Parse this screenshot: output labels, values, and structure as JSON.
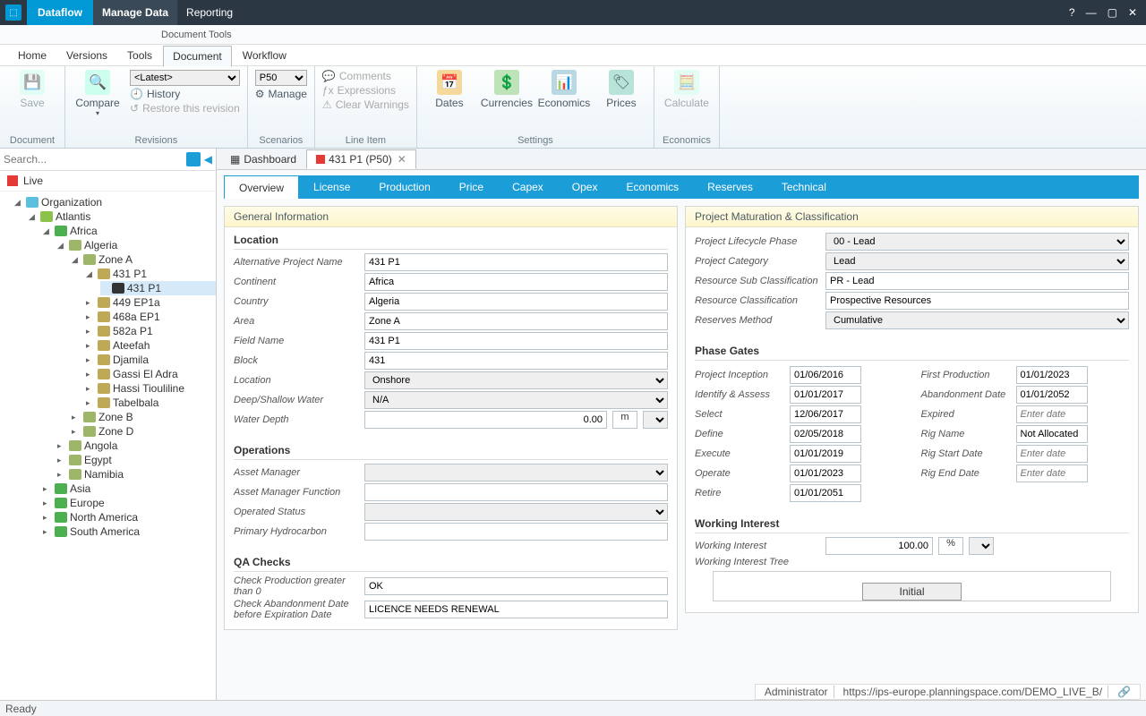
{
  "titlebar": {
    "brand": "Dataflow",
    "tabs": [
      "Manage Data",
      "Reporting"
    ],
    "active": 0
  },
  "contextual": "Document Tools",
  "menu": {
    "items": [
      "Home",
      "Versions",
      "Tools",
      "Document",
      "Workflow"
    ],
    "active": 3
  },
  "ribbon": {
    "document": {
      "label": "Document",
      "save": "Save",
      "compare": "Compare"
    },
    "revisions": {
      "label": "Revisions",
      "dropdown": "<Latest>",
      "history": "History",
      "restore": "Restore this revision"
    },
    "scenarios": {
      "label": "Scenarios",
      "dropdown": "P50",
      "manage": "Manage"
    },
    "lineitem": {
      "label": "Line Item",
      "comments": "Comments",
      "expressions": "Expressions",
      "clear": "Clear Warnings"
    },
    "settings": {
      "label": "Settings",
      "dates": "Dates",
      "currencies": "Currencies",
      "economics": "Economics",
      "prices": "Prices"
    },
    "economics": {
      "label": "Economics",
      "calculate": "Calculate"
    }
  },
  "left": {
    "search_placeholder": "Search...",
    "live": "Live",
    "tree": {
      "root": "Organization",
      "atlantis": "Atlantis",
      "africa": "Africa",
      "algeria": "Algeria",
      "zoneA": "Zone A",
      "p431p1_parent": "431 P1",
      "p431p1": "431 P1",
      "ep449": "449 EP1a",
      "ep468": "468a EP1",
      "p582": "582a P1",
      "ateefah": "Ateefah",
      "djamila": "Djamila",
      "gassi": "Gassi El Adra",
      "hassi": "Hassi Tiouliline",
      "tabel": "Tabelbala",
      "zoneB": "Zone B",
      "zoneD": "Zone D",
      "angola": "Angola",
      "egypt": "Egypt",
      "namibia": "Namibia",
      "asia": "Asia",
      "europe": "Europe",
      "northam": "North America",
      "southam": "South America"
    }
  },
  "doctabs": {
    "dashboard": "Dashboard",
    "active": "431 P1 (P50)"
  },
  "subtabs": [
    "Overview",
    "License",
    "Production",
    "Price",
    "Capex",
    "Opex",
    "Economics",
    "Reserves",
    "Technical"
  ],
  "form": {
    "general_title": "General Information",
    "location_hdr": "Location",
    "location": {
      "alt_name_l": "Alternative Project Name",
      "alt_name": "431 P1",
      "continent_l": "Continent",
      "continent": "Africa",
      "country_l": "Country",
      "country": "Algeria",
      "area_l": "Area",
      "area": "Zone A",
      "field_l": "Field Name",
      "field": "431 P1",
      "block_l": "Block",
      "block": "431",
      "loc_l": "Location",
      "loc": "Onshore",
      "water_l": "Deep/Shallow Water",
      "water": "N/A",
      "depth_l": "Water Depth",
      "depth": "0.00",
      "depth_unit": "m"
    },
    "ops_hdr": "Operations",
    "ops": {
      "mgr_l": "Asset Manager",
      "func_l": "Asset Manager Function",
      "status_l": "Operated Status",
      "hydro_l": "Primary Hydrocarbon"
    },
    "qa_hdr": "QA Checks",
    "qa": {
      "prod_l": "Check Production greater than 0",
      "prod": "OK",
      "aband_l": "Check Abandonment Date before Expiration Date",
      "aband": "LICENCE NEEDS RENEWAL"
    },
    "maturation_title": "Project Maturation & Classification",
    "mat": {
      "phase_l": "Project Lifecycle Phase",
      "phase": "00 - Lead",
      "cat_l": "Project Category",
      "cat": "Lead",
      "sub_l": "Resource Sub Classification",
      "sub": "PR - Lead",
      "class_l": "Resource Classification",
      "class": "Prospective Resources",
      "method_l": "Reserves Method",
      "method": "Cumulative"
    },
    "phase_hdr": "Phase Gates",
    "phase": {
      "inception_l": "Project Inception",
      "inception": "01/06/2016",
      "identify_l": "Identify & Assess",
      "identify": "01/01/2017",
      "select_l": "Select",
      "select": "12/06/2017",
      "define_l": "Define",
      "define": "02/05/2018",
      "execute_l": "Execute",
      "execute": "01/01/2019",
      "operate_l": "Operate",
      "operate": "01/01/2023",
      "retire_l": "Retire",
      "retire": "01/01/2051",
      "firstprod_l": "First Production",
      "firstprod": "01/01/2023",
      "aband_l": "Abandonment Date",
      "aband": "01/01/2052",
      "expired_l": "Expired",
      "expired_ph": "Enter date",
      "rigname_l": "Rig Name",
      "rigname": "Not Allocated",
      "rigstart_l": "Rig Start Date",
      "rigstart_ph": "Enter date",
      "rigend_l": "Rig End Date",
      "rigend_ph": "Enter date"
    },
    "wi_hdr": "Working Interest",
    "wi": {
      "l": "Working Interest",
      "v": "100.00",
      "u": "%",
      "tree_l": "Working Interest Tree",
      "initial": "Initial"
    }
  },
  "status": {
    "ready": "Ready",
    "user": "Administrator",
    "url": "https://ips-europe.planningspace.com/DEMO_LIVE_B/"
  }
}
